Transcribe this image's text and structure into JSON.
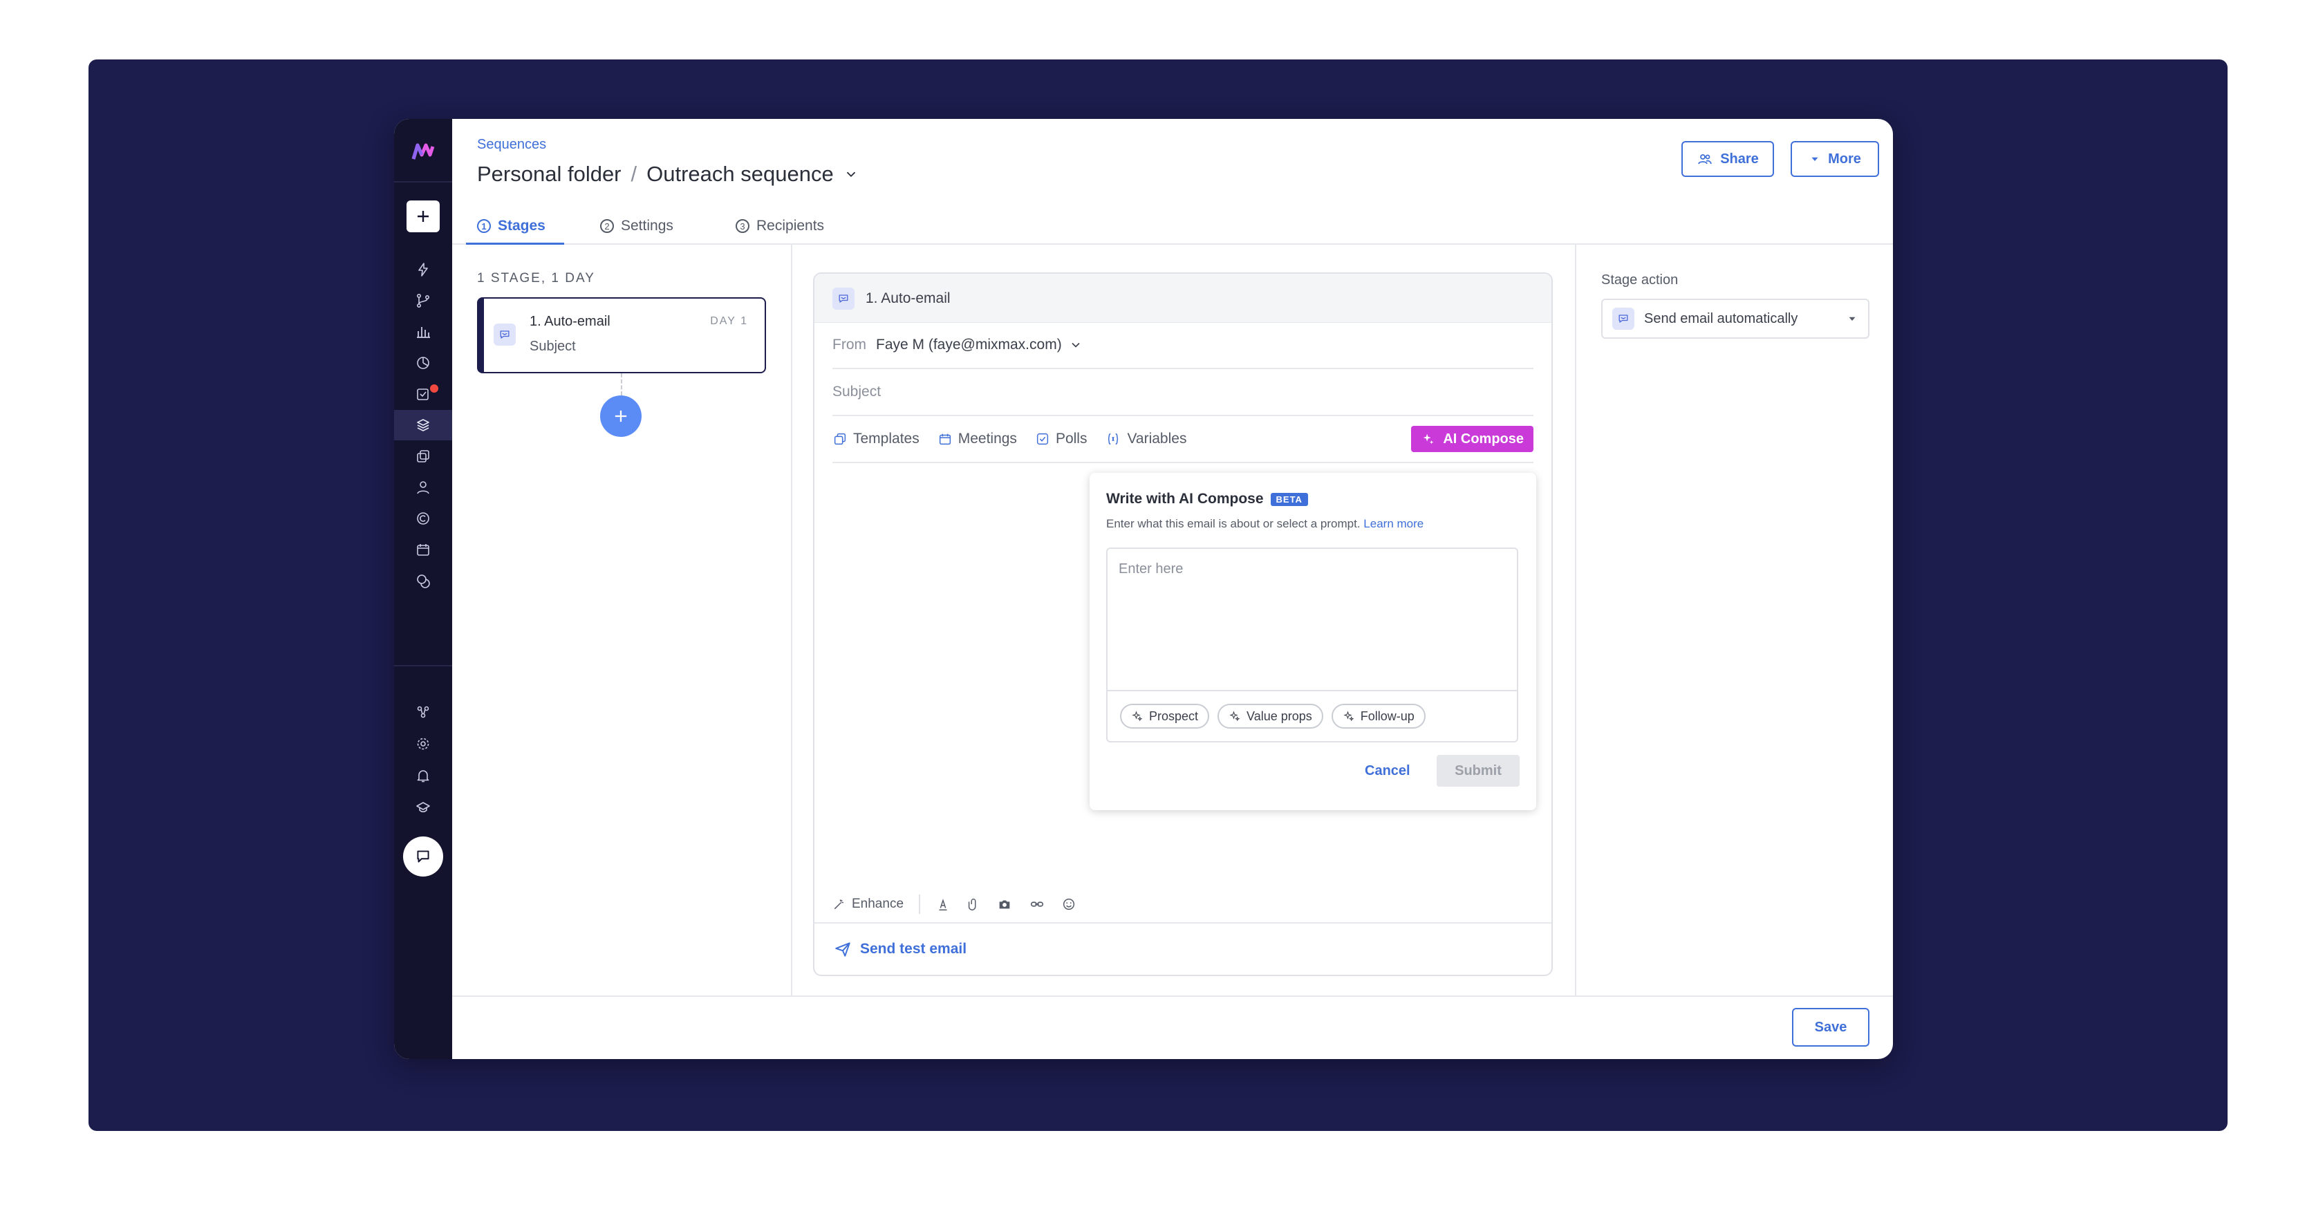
{
  "header": {
    "breadcrumb": "Sequences",
    "folder": "Personal folder",
    "separator": "/",
    "sequence_name": "Outreach sequence",
    "share_label": "Share",
    "more_label": "More"
  },
  "tabs": [
    {
      "num": "1",
      "label": "Stages",
      "active": true
    },
    {
      "num": "2",
      "label": "Settings",
      "active": false
    },
    {
      "num": "3",
      "label": "Recipients",
      "active": false
    }
  ],
  "stages_panel": {
    "summary": "1 STAGE, 1 DAY",
    "stage": {
      "name": "1. Auto-email",
      "subject": "Subject",
      "day": "DAY 1"
    }
  },
  "editor": {
    "header_label": "1. Auto-email",
    "from_label": "From",
    "from_value": "Faye M (faye@mixmax.com)",
    "subject_placeholder": "Subject",
    "tools": {
      "templates": "Templates",
      "meetings": "Meetings",
      "polls": "Polls",
      "variables": "Variables",
      "ai_compose": "AI Compose"
    },
    "enhance_label": "Enhance",
    "send_test_label": "Send test email"
  },
  "ai_compose": {
    "title": "Write with AI Compose",
    "badge": "BETA",
    "description": "Enter what this email is about or select a prompt.",
    "learn_more": "Learn more",
    "placeholder": "Enter here",
    "chips": [
      "Prospect",
      "Value props",
      "Follow-up"
    ],
    "cancel_label": "Cancel",
    "submit_label": "Submit"
  },
  "stage_action": {
    "label": "Stage action",
    "value": "Send email automatically"
  },
  "footer": {
    "save_label": "Save"
  },
  "colors": {
    "frame_bg": "#1c1c4d",
    "sidebar_bg": "#13132e",
    "accent_blue": "#3f6fd8",
    "ai_purple": "#c93ad9",
    "add_button": "#5b8cf5",
    "notification": "#f0483e"
  }
}
